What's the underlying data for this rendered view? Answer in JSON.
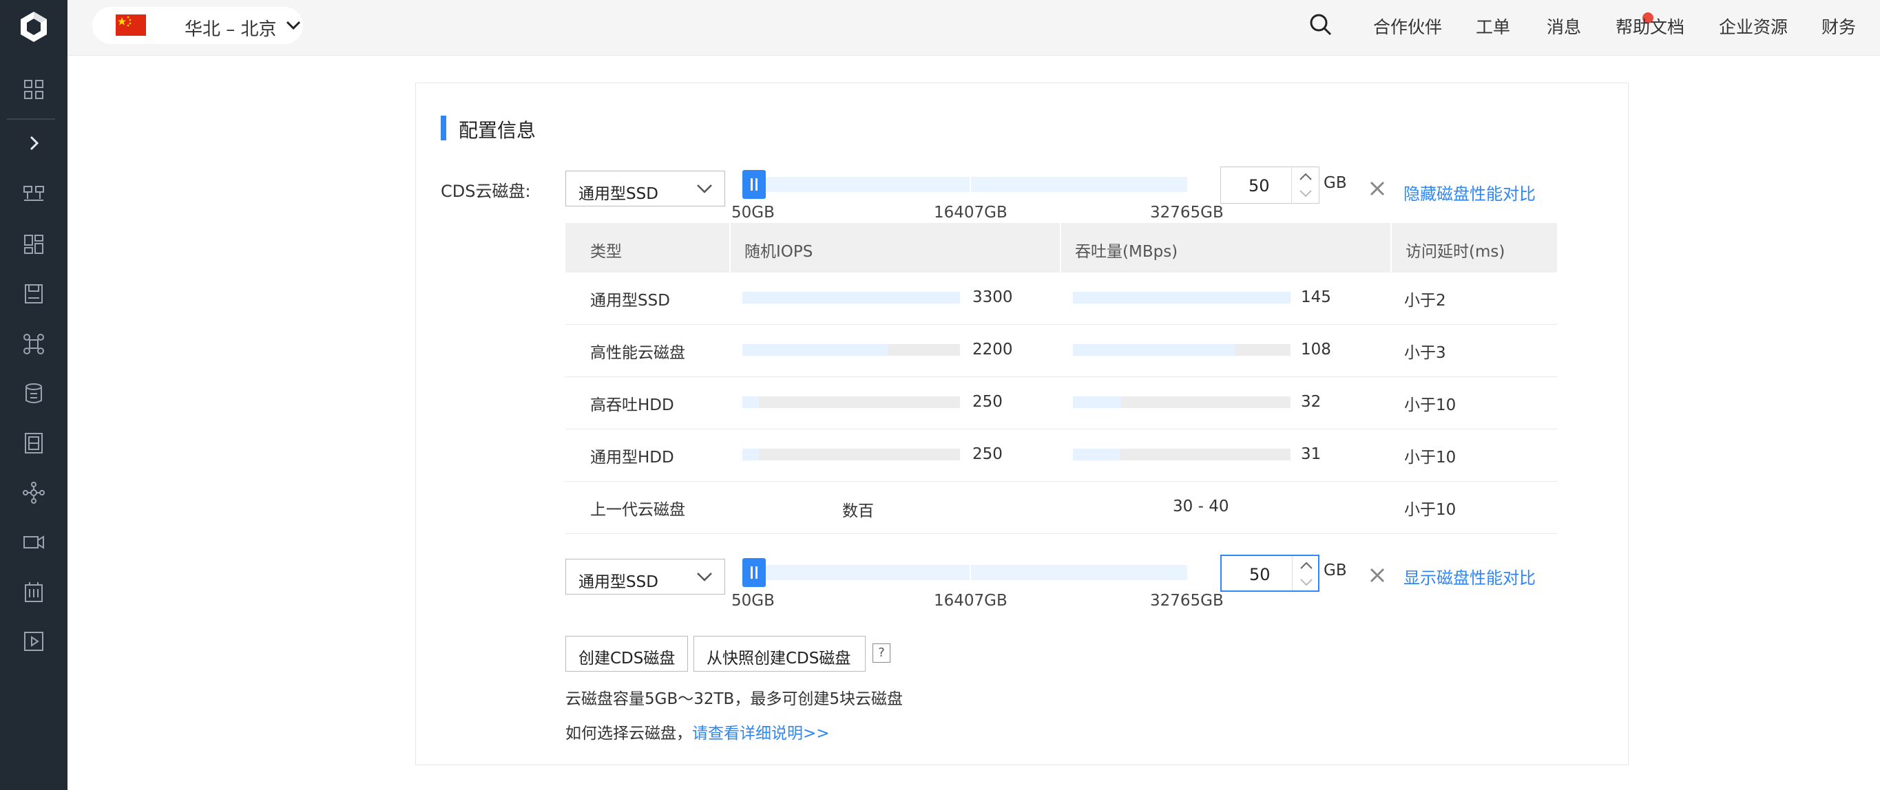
{
  "topbar": {
    "region": "华北 – 北京",
    "nav": [
      "合作伙伴",
      "工单",
      "消息",
      "帮助文档",
      "企业资源",
      "财务"
    ]
  },
  "section": {
    "title": "配置信息"
  },
  "cds": {
    "label": "CDS云磁盘:",
    "disks": [
      {
        "type": "通用型SSD",
        "size": "50",
        "size_fraction": 0.0,
        "unit": "GB",
        "ticks": [
          "50GB",
          "16407GB",
          "32765GB"
        ],
        "compare_link": "隐藏磁盘性能对比"
      },
      {
        "type": "通用型SSD",
        "size": "50",
        "size_fraction": 0.0,
        "unit": "GB",
        "ticks": [
          "50GB",
          "16407GB",
          "32765GB"
        ],
        "compare_link": "显示磁盘性能对比"
      }
    ]
  },
  "perf_table": {
    "headers": [
      "类型",
      "随机IOPS",
      "吞吐量(MBps)",
      "访问延时(ms)"
    ],
    "rows": [
      {
        "type": "通用型SSD",
        "iops": "3300",
        "iops_fraction": 1.0,
        "throughput": "145",
        "throughput_fraction": 1.0,
        "latency": "小于2"
      },
      {
        "type": "高性能云磁盘",
        "iops": "2200",
        "iops_fraction": 0.67,
        "throughput": "108",
        "throughput_fraction": 0.745,
        "latency": "小于3"
      },
      {
        "type": "高吞吐HDD",
        "iops": "250",
        "iops_fraction": 0.076,
        "throughput": "32",
        "throughput_fraction": 0.22,
        "latency": "小于10"
      },
      {
        "type": "通用型HDD",
        "iops": "250",
        "iops_fraction": 0.076,
        "throughput": "31",
        "throughput_fraction": 0.214,
        "latency": "小于10"
      },
      {
        "type": "上一代云磁盘",
        "iops": "数百",
        "throughput": "30 - 40",
        "latency": "小于10"
      }
    ]
  },
  "actions": {
    "create": "创建CDS磁盘",
    "create_from_snapshot": "从快照创建CDS磁盘",
    "help": "?"
  },
  "notes": {
    "capacity": "云磁盘容量5GB～32TB，最多可创建5块云磁盘",
    "howto_prefix": "如何选择云磁盘，",
    "howto_link": "请查看详细说明>>"
  },
  "colors": {
    "accent": "#2f86f6",
    "sidebar": "#222a34",
    "badge": "#e84c3d"
  }
}
